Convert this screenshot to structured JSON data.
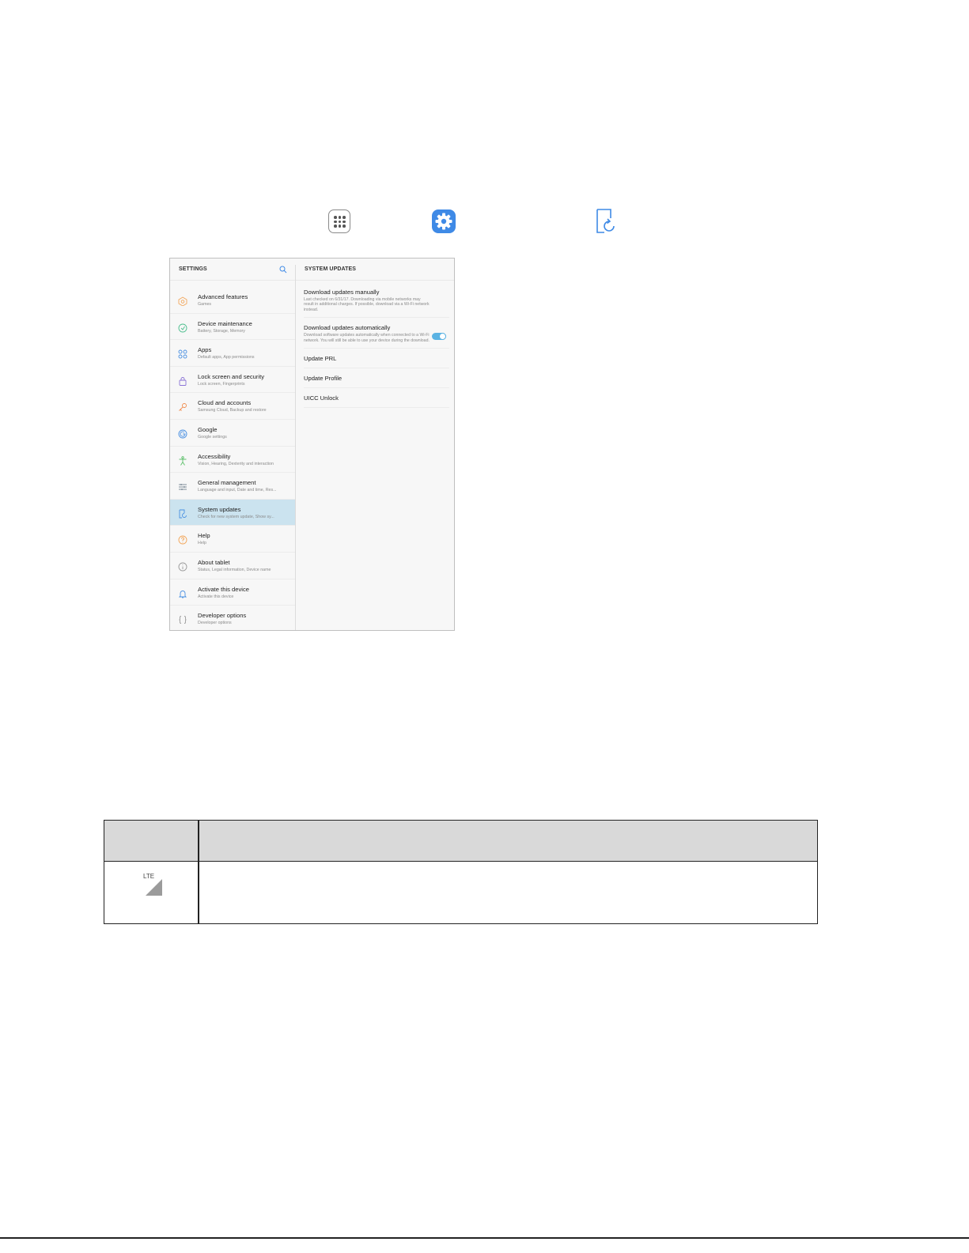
{
  "icons_row": {
    "apps": "apps-grid-icon",
    "settings": "settings-gear-icon",
    "system_updates": "system-updates-icon"
  },
  "screen": {
    "left_header": "SETTINGS",
    "right_header": "SYSTEM UPDATES",
    "settings_items": [
      {
        "title": "Advanced features",
        "subtitle": "Games",
        "icon": "advanced-features-icon",
        "color": "#f2a65a"
      },
      {
        "title": "Device maintenance",
        "subtitle": "Battery, Storage, Memory",
        "icon": "device-maintenance-icon",
        "color": "#4fbf8f"
      },
      {
        "title": "Apps",
        "subtitle": "Default apps, App permissions",
        "icon": "apps-icon",
        "color": "#4a90e2"
      },
      {
        "title": "Lock screen and security",
        "subtitle": "Lock screen, Fingerprints",
        "icon": "lock-icon",
        "color": "#8b73d6"
      },
      {
        "title": "Cloud and accounts",
        "subtitle": "Samsung Cloud, Backup and restore",
        "icon": "key-icon",
        "color": "#f08a4b"
      },
      {
        "title": "Google",
        "subtitle": "Google settings",
        "icon": "google-icon",
        "color": "#4a90e2"
      },
      {
        "title": "Accessibility",
        "subtitle": "Vision, Hearing, Dexterity and interaction",
        "icon": "accessibility-icon",
        "color": "#5cbf6a"
      },
      {
        "title": "General management",
        "subtitle": "Language and input, Date and time, Res...",
        "icon": "sliders-icon",
        "color": "#7f8c99"
      },
      {
        "title": "System updates",
        "subtitle": "Check for new system update, Show sy...",
        "icon": "system-updates-icon",
        "color": "#4a90e2",
        "active": true
      },
      {
        "title": "Help",
        "subtitle": "Help",
        "icon": "help-icon",
        "color": "#f2a65a"
      },
      {
        "title": "About tablet",
        "subtitle": "Status, Legal information, Device name",
        "icon": "info-icon",
        "color": "#9a9a9a"
      },
      {
        "title": "Activate this device",
        "subtitle": "Activate this device",
        "icon": "bell-icon",
        "color": "#4a90e2"
      },
      {
        "title": "Developer options",
        "subtitle": "Developer options",
        "icon": "braces-icon",
        "color": "#9a9a9a"
      }
    ],
    "updates": {
      "manual_title": "Download updates manually",
      "manual_desc": "Last checked on 6/31/17. Downloading via mobile networks may result in additional charges. If possible, download via a Wi-Fi network instead.",
      "auto_title": "Download updates automatically",
      "auto_desc": "Download software updates automatically when connected to a Wi-Fi network. You will still be able to use your device during the download.",
      "auto_enabled": true,
      "prl": "Update PRL",
      "profile": "Update Profile",
      "uicc": "UICC Unlock"
    }
  },
  "table": {
    "lte_label": "LTE"
  },
  "colors": {
    "settings_blue": "#3f8ae6",
    "active_row": "#cbe3ef",
    "toggle_on": "#5bb3e3",
    "table_header": "#d9d9d9"
  }
}
